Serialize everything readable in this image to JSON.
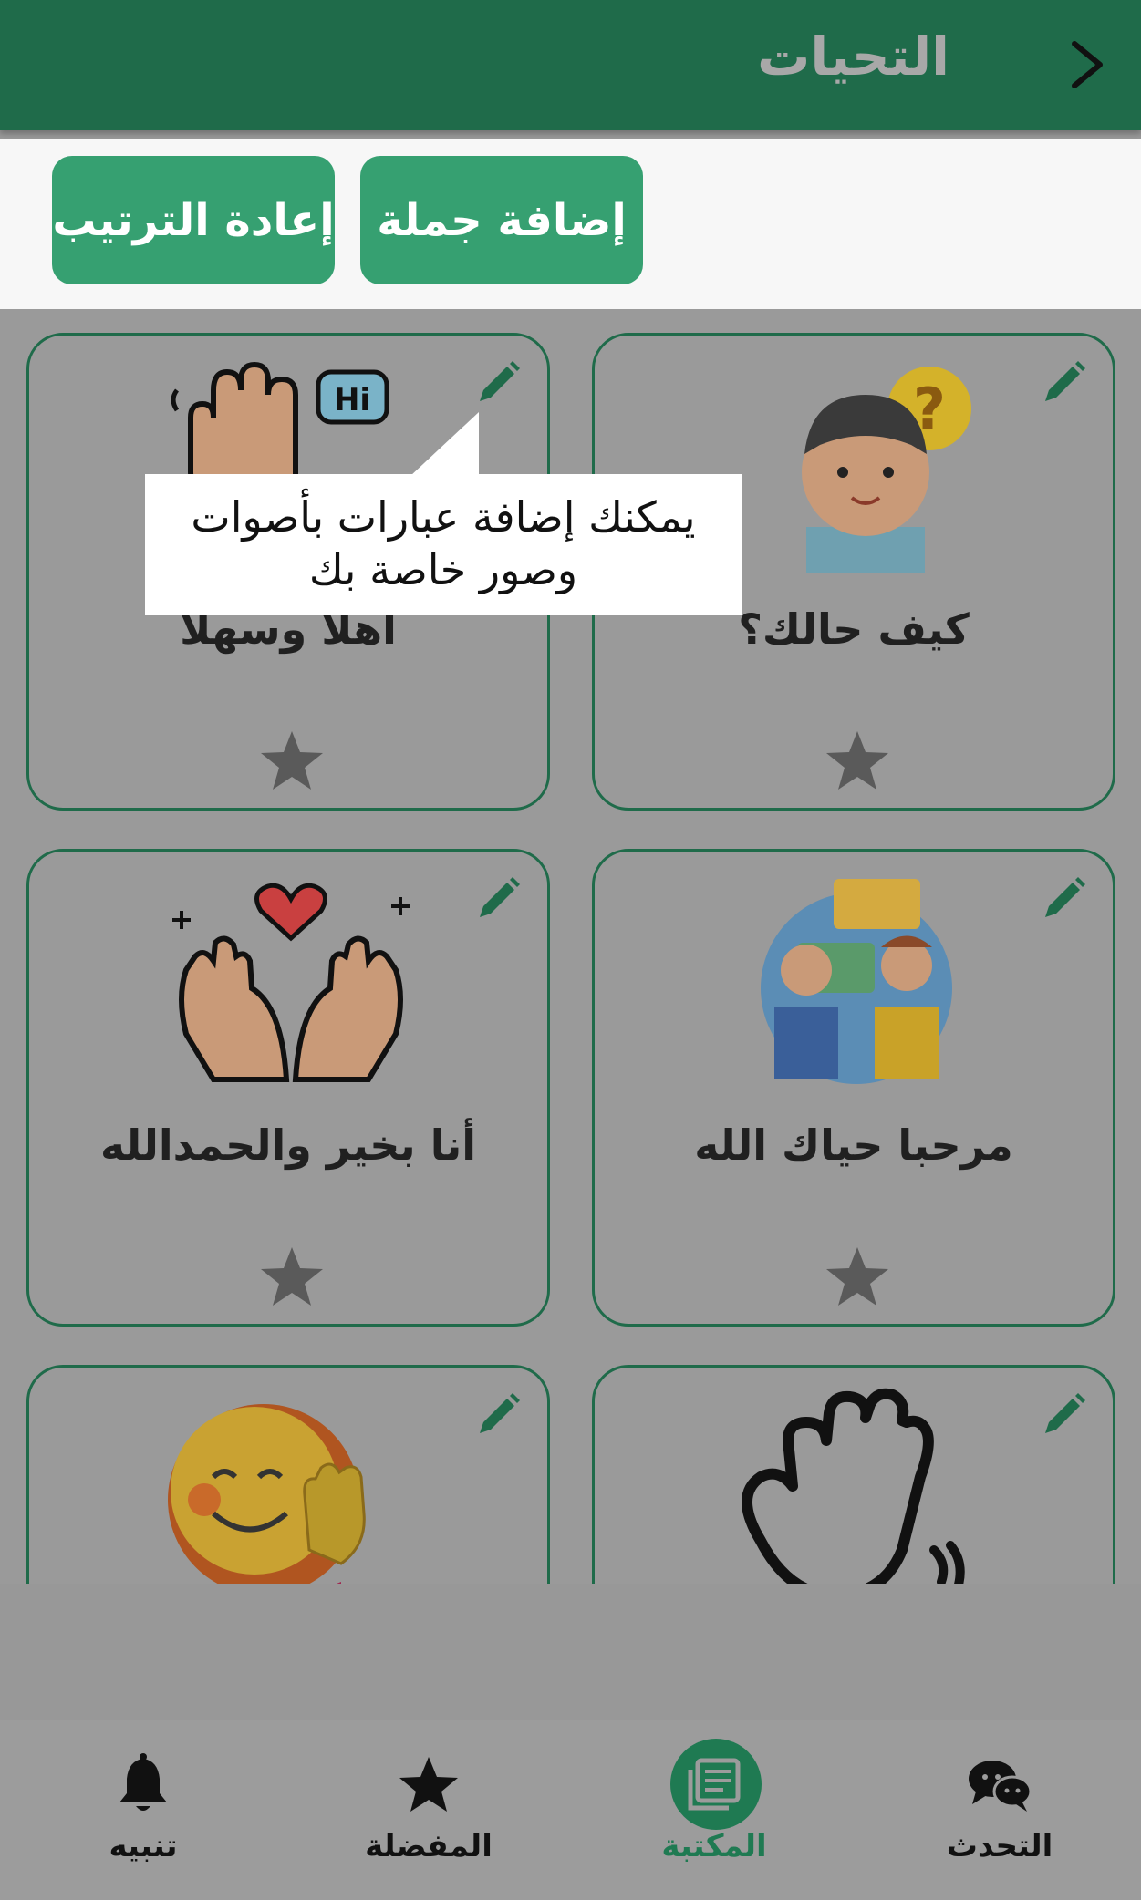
{
  "header": {
    "title": "التحيات",
    "back_icon": "chevron-right-icon"
  },
  "actions": {
    "add_label": "إضافة جملة",
    "reorder_label": "إعادة الترتيب"
  },
  "cards": [
    {
      "label": "كيف حالك؟",
      "image": "confused-person-icon",
      "starred": false
    },
    {
      "label": "أهلا وسهلا",
      "image": "hi-hand-icon",
      "starred": false
    },
    {
      "label": "مرحبا حياك الله",
      "image": "handshake-chat-icon",
      "starred": false
    },
    {
      "label": "أنا بخير والحمدالله",
      "image": "praying-hands-heart-icon",
      "starred": false
    },
    {
      "label": "",
      "image": "waving-hand-icon",
      "starred": false
    },
    {
      "label": "",
      "image": "smiley-wave-icon",
      "starred": false
    }
  ],
  "tooltip": {
    "text_line1": "يمكنك إضافة عبارات بأصوات",
    "text_line2": "وصور خاصة بك"
  },
  "bottom_nav": [
    {
      "label": "التحدث",
      "icon": "chat-icon",
      "active": false
    },
    {
      "label": "المكتبة",
      "icon": "library-icon",
      "active": true
    },
    {
      "label": "المفضلة",
      "icon": "star-icon",
      "active": false
    },
    {
      "label": "تنبيه",
      "icon": "bell-icon",
      "active": false
    }
  ],
  "colors": {
    "primary": "#1f6b4a",
    "button": "#36a071",
    "overlay": "#9a9a9a",
    "active_nav": "#1f7a52"
  }
}
